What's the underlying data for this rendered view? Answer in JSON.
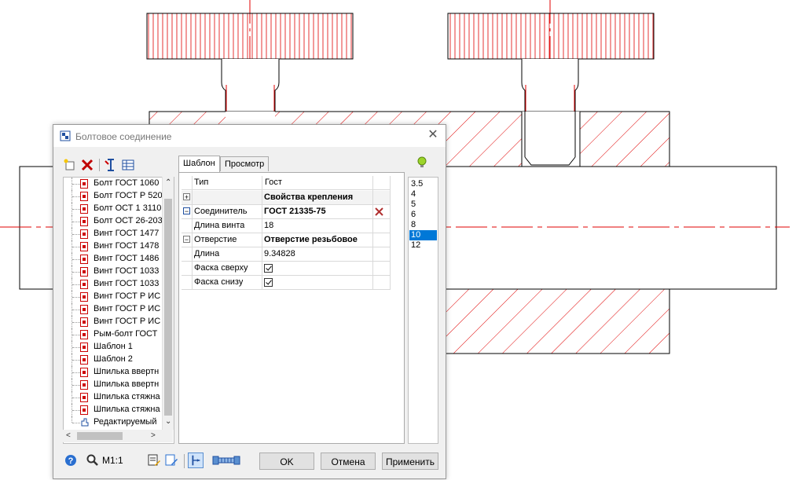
{
  "dialog": {
    "title": "Болтовое соединение",
    "close_glyph": "✕"
  },
  "tree": {
    "items": [
      {
        "label": "Болт ГОСТ 1060"
      },
      {
        "label": "Болт ГОСТ Р 520"
      },
      {
        "label": "Болт ОСТ 1 3110"
      },
      {
        "label": "Болт ОСТ 26-203"
      },
      {
        "label": "Винт ГОСТ 1477"
      },
      {
        "label": "Винт ГОСТ 1478"
      },
      {
        "label": "Винт ГОСТ 1486"
      },
      {
        "label": "Винт ГОСТ 1033"
      },
      {
        "label": "Винт ГОСТ 1033"
      },
      {
        "label": "Винт ГОСТ Р ИС"
      },
      {
        "label": "Винт ГОСТ Р ИС"
      },
      {
        "label": "Винт ГОСТ Р ИС"
      },
      {
        "label": "Рым-болт ГОСТ"
      },
      {
        "label": "Шаблон 1"
      },
      {
        "label": "Шаблон 2"
      },
      {
        "label": "Шпилька ввертн"
      },
      {
        "label": "Шпилька ввертн"
      },
      {
        "label": "Шпилька стяжна"
      },
      {
        "label": "Шпилька стяжна"
      },
      {
        "label": "Редактируемый"
      }
    ]
  },
  "tabs": [
    {
      "label": "Шаблон"
    },
    {
      "label": "Просмотр"
    }
  ],
  "grid": {
    "headers": {
      "type": "Тип",
      "gost": "Гост"
    },
    "rows": [
      {
        "expander": "+",
        "name": "",
        "value": "Свойства крепления"
      },
      {
        "expander": "−",
        "name": "Соединитель",
        "value": "ГОСТ 21335-75"
      },
      {
        "expander": "",
        "name": "Длина винта",
        "value": "18"
      },
      {
        "expander": "−",
        "name": "Отверстие",
        "value": "Отверстие резьбовое"
      },
      {
        "expander": "",
        "name": "Длина",
        "value": "9.34828"
      },
      {
        "expander": "",
        "name": "Фаска сверху",
        "value": ""
      },
      {
        "expander": "",
        "name": "Фаска снизу",
        "value": ""
      }
    ]
  },
  "sizes": {
    "items": [
      "3.5",
      "4",
      "5",
      "6",
      "8",
      "10",
      "12"
    ],
    "selected": "10"
  },
  "footer": {
    "scale_label": "М1:1",
    "ok": "OK",
    "cancel": "Отмена",
    "apply": "Применить"
  },
  "colors": {
    "drawing_red": "#e00000",
    "selection_blue": "#0078d7"
  }
}
